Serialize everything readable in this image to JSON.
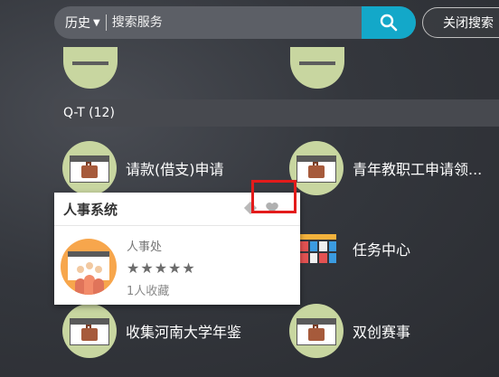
{
  "search": {
    "history_label": "历史",
    "placeholder": "搜索服务",
    "close_label": "关闭搜索"
  },
  "section": {
    "title": "Q-T (12)"
  },
  "apps": [
    {
      "label": "请款(借支)申请"
    },
    {
      "label": "青年教职工申请领..."
    },
    {
      "label": "任务中心"
    },
    {
      "label": "收集河南大学年鉴"
    },
    {
      "label": "双创赛事"
    }
  ],
  "popup": {
    "title": "人事系统",
    "department": "人事处",
    "rating": "★★★★★",
    "favorites": "1人收藏"
  },
  "colors": {
    "accent": "#13a8c9",
    "icon_bg": "#c8d6a0",
    "highlight": "#e31b1b"
  }
}
